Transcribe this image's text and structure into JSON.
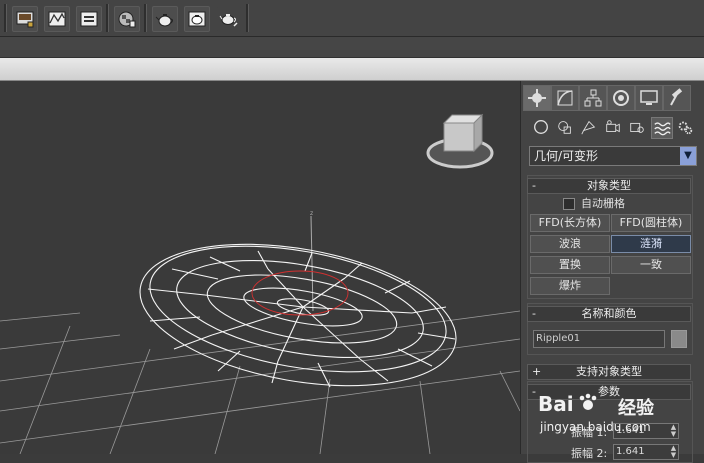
{
  "toolbar": {
    "buttons": [
      {
        "icon": "render-setup-icon"
      },
      {
        "icon": "curve-editor-icon"
      },
      {
        "icon": "render-frame-icon"
      },
      {
        "icon": "material-editor-icon"
      },
      {
        "icon": "render-teapot-icon"
      },
      {
        "icon": "render-teapot-2-icon"
      },
      {
        "icon": "quick-render-teapot-icon"
      }
    ]
  },
  "panel": {
    "category_dropdown": "几何/可变形",
    "rollouts": {
      "object_type": {
        "title": "对象类型",
        "autogrid_label": "自动栅格",
        "buttons": [
          "FFD(长方体)",
          "FFD(圆柱体)",
          "波浪",
          "涟漪",
          "置换",
          "一致",
          "爆炸"
        ],
        "active": "涟漪"
      },
      "name_color": {
        "title": "名称和颜色",
        "name_value": "Ripple01"
      },
      "supports": {
        "title": "支持对象类型"
      },
      "params": {
        "title": "参数",
        "field1_label": "振幅 1:",
        "field1_value": "1.641",
        "field2_label": "振幅 2:",
        "field2_value": "1.641"
      }
    }
  },
  "watermark": {
    "brand_a": "Bai",
    "brand_b": "经验",
    "url": "jingyan.baidu.com"
  },
  "colors": {
    "accent_active": "#2f3a4a",
    "dropdown_arrow": "#8aa0d8"
  }
}
